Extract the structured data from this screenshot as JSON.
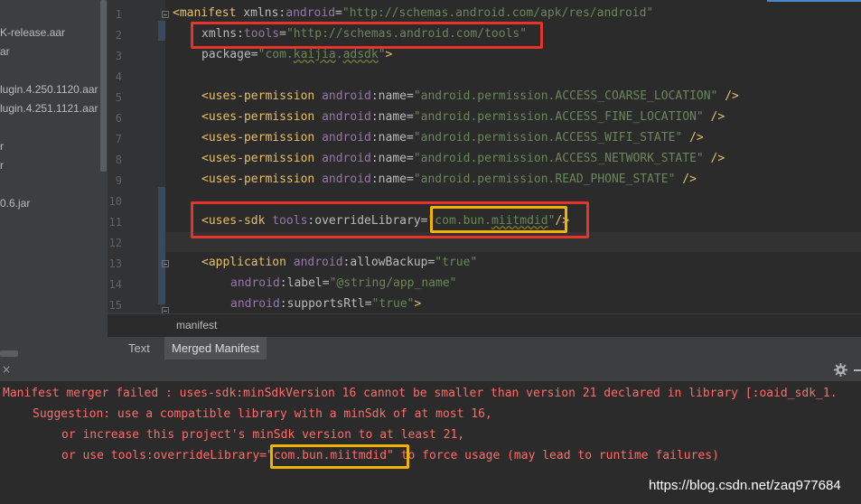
{
  "sidebar": {
    "items": [
      {
        "label": "K-release.aar"
      },
      {
        "label": "ar"
      },
      {
        "label": "lugin.4.250.1120.aar"
      },
      {
        "label": "lugin.4.251.1121.aar"
      },
      {
        "label": "r"
      },
      {
        "label": "r"
      },
      {
        "label": "0.6.jar"
      }
    ]
  },
  "editor": {
    "line_numbers": [
      "1",
      "2",
      "3",
      "4",
      "5",
      "6",
      "7",
      "8",
      "9",
      "10",
      "11",
      "12",
      "13",
      "14",
      "15"
    ],
    "lines": {
      "l1_open": "<",
      "l1_tag": "manifest",
      "l1_ns": "xmlns",
      "l1_colon": ":",
      "l1_attr": "android",
      "l1_eq": "=",
      "l1_val": "\"http://schemas.android.com/apk/res/android\"",
      "l2_ns": "xmlns",
      "l2_colon": ":",
      "l2_attr": "tools",
      "l2_eq": "=",
      "l2_val": "\"http://schemas.android.com/tools\"",
      "l3_attr": "package",
      "l3_eq": "=",
      "l3_val_q1": "\"com.",
      "l3_val_k": "kaijia",
      "l3_val_d": ".",
      "l3_val_a": "adsdk",
      "l3_val_q2": "\"",
      "l3_close": ">",
      "perm_tag": "<uses-permission",
      "perm_ns": "android",
      "perm_attr": ":name",
      "perm_eq": "=",
      "perm_close": " />",
      "l5_val": "\"android.permission.ACCESS_COARSE_LOCATION\"",
      "l6_val": "\"android.permission.ACCESS_FINE_LOCATION\"",
      "l7_val": "\"android.permission.ACCESS_WIFI_STATE\"",
      "l8_val": "\"android.permission.ACCESS_NETWORK_STATE\"",
      "l9_val": "\"android.permission.READ_PHONE_STATE\"",
      "l11_tag": "<uses-sdk",
      "l11_ns": "tools",
      "l11_attr": ":overrideLibrary",
      "l11_eq": "=",
      "l11_val_a": "\"com.bun.",
      "l11_val_b": "miitmdid",
      "l11_val_c": "\"",
      "l11_close": "/>",
      "l13_tag": "<application",
      "l13_ns": "android",
      "l13_attr": ":allowBackup",
      "l13_eq": "=",
      "l13_val": "\"true\"",
      "l14_ns": "android",
      "l14_attr": ":label",
      "l14_eq": "=",
      "l14_val": "\"@string/app_name\"",
      "l15_ns": "android",
      "l15_attr": ":supportsRtl",
      "l15_eq": "=",
      "l15_val": "\"true\"",
      "l15_close": ">"
    }
  },
  "breadcrumb": "manifest",
  "tabs": [
    {
      "label": "Text",
      "active": false
    },
    {
      "label": "Merged Manifest",
      "active": true
    }
  ],
  "console": {
    "close_icon": "×",
    "line1": "Manifest merger failed : uses-sdk:minSdkVersion 16 cannot be smaller than version 21 declared in library [:oaid_sdk_1.",
    "line2": "Suggestion: use a compatible library with a minSdk of at most 16,",
    "line3": "or increase this project's minSdk version to at least 21,",
    "line4_a": "or use tools:overrideLibrary=",
    "line4_b": "\"com.bun.miitmdid\"",
    "line4_c": " to force usage (may lead to runtime failures)"
  },
  "watermark": "https://blog.csdn.net/zaq977684",
  "colors": {
    "highlight_red": "#e8332b",
    "highlight_yellow": "#f3b200",
    "error_text": "#ff6b68",
    "xml_tag": "#e8bf6a",
    "xml_value": "#6a8759",
    "xml_namespace": "#9876aa"
  },
  "icons": [
    "gear-icon",
    "minus-icon",
    "close-icon",
    "fold-icon"
  ]
}
